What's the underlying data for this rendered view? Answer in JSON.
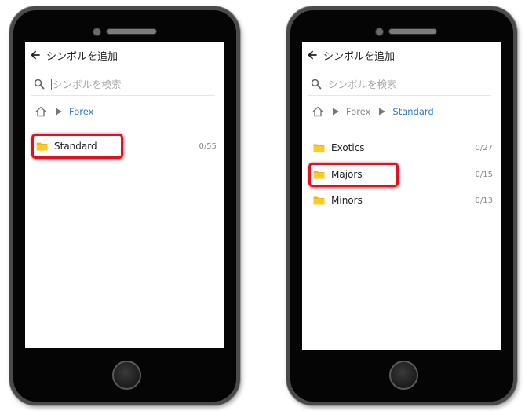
{
  "left_screen": {
    "header_title": "シンボルを追加",
    "search_placeholder": "シンボルを検索",
    "breadcrumb": [
      "Forex"
    ],
    "folders": [
      {
        "label": "Standard",
        "count": "0/55"
      }
    ]
  },
  "right_screen": {
    "header_title": "シンボルを追加",
    "search_placeholder": "シンボルを検索",
    "breadcrumb": [
      "Forex",
      "Standard"
    ],
    "folders": [
      {
        "label": "Exotics",
        "count": "0/27"
      },
      {
        "label": "Majors",
        "count": "0/15"
      },
      {
        "label": "Minors",
        "count": "0/13"
      }
    ]
  },
  "icons": {
    "back": "arrow-left-icon",
    "search": "search-icon",
    "home": "home-icon",
    "breadcrumb_separator": "triangle-right-icon",
    "folder": "folder-icon"
  },
  "colors": {
    "link_blue": "#2a7bd4",
    "folder_yellow": "#f5b800",
    "highlight_red": "#e0111e",
    "phone_body": "#050505"
  }
}
